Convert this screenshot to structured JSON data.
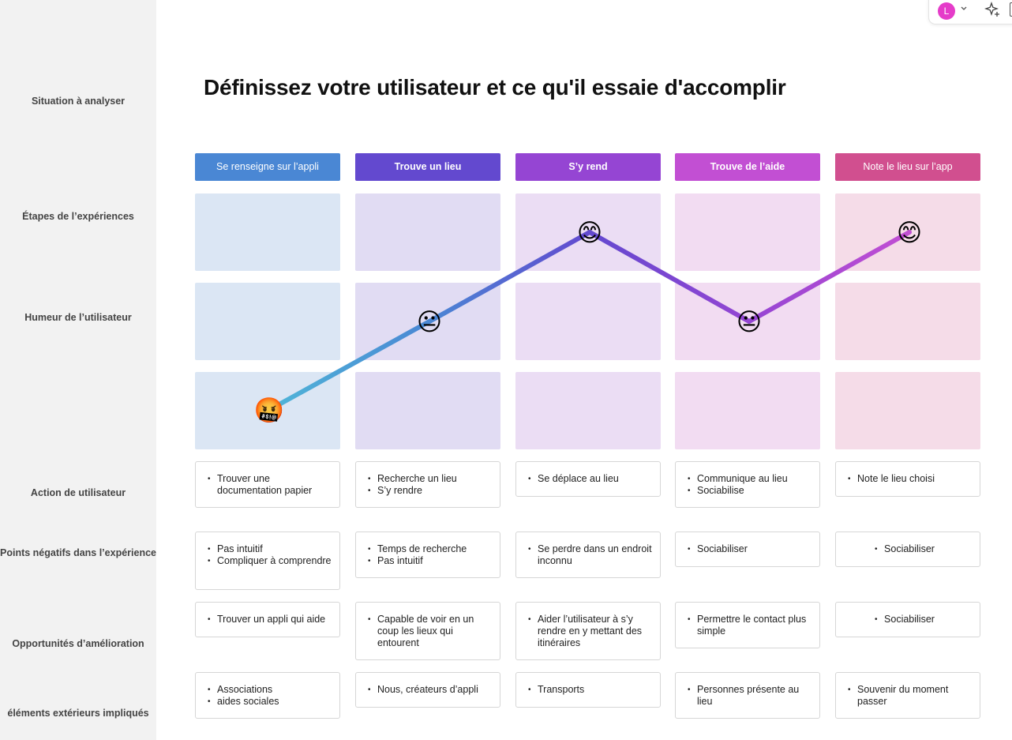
{
  "title": "Définissez votre utilisateur et ce qu'il essaie d'accomplir",
  "user": {
    "avatar_initial": "L"
  },
  "row_labels": {
    "situation": "Situation à analyser",
    "etapes": "Étapes de l’expériences",
    "humeur": "Humeur de l’utilisateur",
    "action": "Action de utilisateur",
    "negatifs": "Points négatifs dans l’expérience",
    "opportunites": "Opportunités d’amélioration",
    "exterieurs": "éléments extérieurs impliqués"
  },
  "stages": [
    {
      "label": "Se renseigne sur l’appli",
      "color": "#4a87d4",
      "cell_color": "#dbe6f4"
    },
    {
      "label": "Trouve un lieu",
      "color": "#6349cf",
      "cell_color": "#e1dcf3"
    },
    {
      "label": "S’y rend",
      "color": "#9545d3",
      "cell_color": "#ebddf4"
    },
    {
      "label": "Trouve de l’aide",
      "color": "#c24fd3",
      "cell_color": "#f2dcf2"
    },
    {
      "label": "Note le lieu sur l’app",
      "color": "#d14f8f",
      "cell_color": "#f5dce8"
    }
  ],
  "mood": {
    "levels": [
      "happy",
      "neutral",
      "angry"
    ],
    "points": [
      {
        "stage": 0,
        "mood": "angry",
        "emoji": "🤬"
      },
      {
        "stage": 1,
        "mood": "neutral",
        "emoji": "😐"
      },
      {
        "stage": 2,
        "mood": "happy",
        "emoji": "😊"
      },
      {
        "stage": 3,
        "mood": "neutral",
        "emoji": "😐"
      },
      {
        "stage": 4,
        "mood": "happy",
        "emoji": "😊"
      }
    ],
    "line_colors": [
      "#4fb6d8",
      "#4a87d4",
      "#6349cf",
      "#9545d3",
      "#c24fd3"
    ]
  },
  "actions": [
    [
      "Trouver une documentation papier"
    ],
    [
      "Recherche un lieu",
      "S’y rendre"
    ],
    [
      "Se déplace au lieu"
    ],
    [
      "Communique au lieu",
      "Sociabilise"
    ],
    [
      "Note le lieu choisi"
    ]
  ],
  "negatifs": [
    [
      "Pas intuitif",
      "Compliquer à comprendre"
    ],
    [
      "Temps de recherche",
      "Pas intuitif"
    ],
    [
      "Se perdre dans un endroit inconnu"
    ],
    [
      "Sociabiliser"
    ],
    [
      "Sociabiliser"
    ]
  ],
  "opportunites": [
    [
      "Trouver un appli qui aide"
    ],
    [
      "Capable de voir en un coup les lieux qui entourent"
    ],
    [
      "Aider l’utilisateur à s’y rendre en y mettant des itinéraires"
    ],
    [
      "Permettre le contact plus simple"
    ],
    [
      "Sociabiliser"
    ]
  ],
  "exterieurs": [
    [
      "Associations",
      "aides sociales"
    ],
    [
      "Nous, créateurs d’appli"
    ],
    [
      "Transports"
    ],
    [
      "Personnes présente au lieu"
    ],
    [
      "Souvenir du moment passer"
    ]
  ]
}
